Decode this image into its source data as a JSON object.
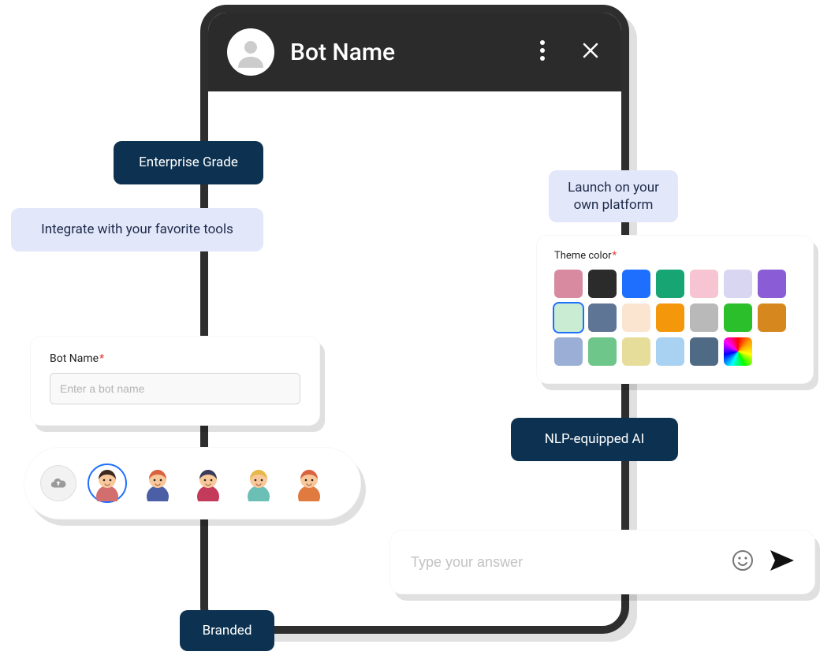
{
  "phone": {
    "title": "Bot Name"
  },
  "pills": {
    "enterprise": "Enterprise Grade",
    "integrate": "Integrate with your favorite tools",
    "launch": "Launch on your\nown platform",
    "nlp": "NLP-equipped AI",
    "branded": "Branded"
  },
  "botname": {
    "label": "Bot Name",
    "placeholder": "Enter a bot name"
  },
  "theme": {
    "label": "Theme color",
    "selected_index": 7,
    "colors": [
      "#d88aa0",
      "#2b2b2b",
      "#1f6fff",
      "#17a673",
      "#f7c5d1",
      "#d8d6f0",
      "#8a5cd6",
      "#c9ecd3",
      "#5f7595",
      "#fce5d0",
      "#f4970b",
      "#b9b9b9",
      "#2bbf2b",
      "#d6881f",
      "#9aaed6",
      "#6fc68a",
      "#e6dd9b",
      "#a9d1f2",
      "#4f6a85",
      "rainbow"
    ]
  },
  "chat": {
    "placeholder": "Type your answer"
  },
  "avatars": {
    "selected_index": 0,
    "items": [
      {
        "hair": "#3e2a1f",
        "skin": "#f8c89a",
        "shirt": "#d36e6e"
      },
      {
        "hair": "#d8633e",
        "skin": "#f8c89a",
        "shirt": "#4a5fa5"
      },
      {
        "hair": "#3a3a5a",
        "skin": "#f8c89a",
        "shirt": "#c43a5a"
      },
      {
        "hair": "#e6b84a",
        "skin": "#f8c89a",
        "shirt": "#6bbfb4"
      },
      {
        "hair": "#d8633e",
        "skin": "#f8c89a",
        "shirt": "#e07a3e"
      }
    ]
  }
}
